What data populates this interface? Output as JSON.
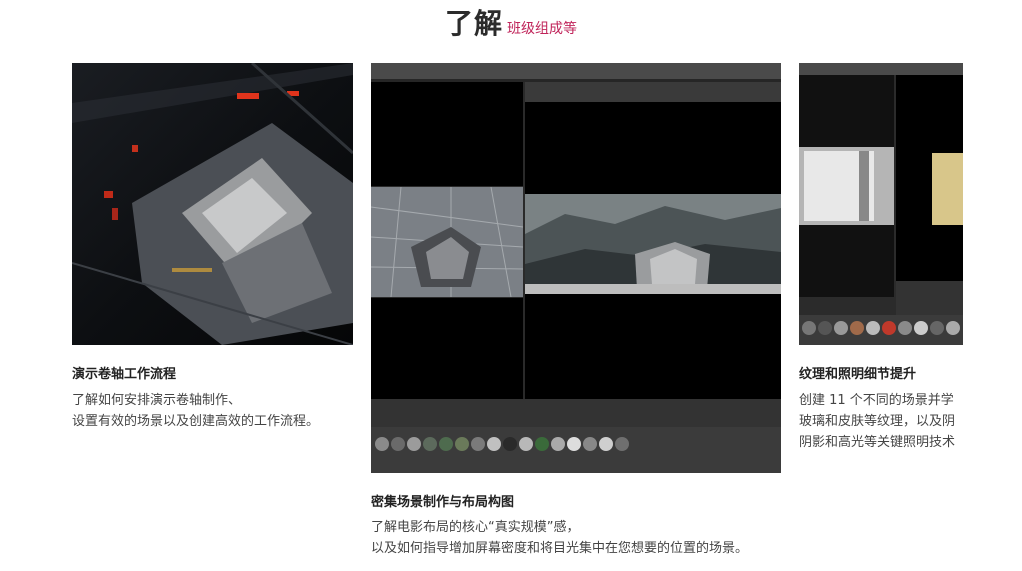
{
  "heading": {
    "main": "了解",
    "sub": "班级组成等"
  },
  "cards": [
    {
      "title": "演示卷轴工作流程",
      "lines": [
        "了解如何安排演示卷轴制作、",
        "设置有效的场景以及创建高效的工作流程。"
      ]
    },
    {
      "title": "密集场景制作与布局构图",
      "lines": [
        "了解电影布局的核心“真实规模”感，",
        "以及如何指导增加屏幕密度和将目光集中在您想要的位置的场景。"
      ]
    },
    {
      "title": "纹理和照明细节提升",
      "lines": [
        "创建 11 个不同的场景并学",
        "玻璃和皮肤等纹理，以及阴",
        "阴影和高光等关键照明技术"
      ]
    }
  ]
}
